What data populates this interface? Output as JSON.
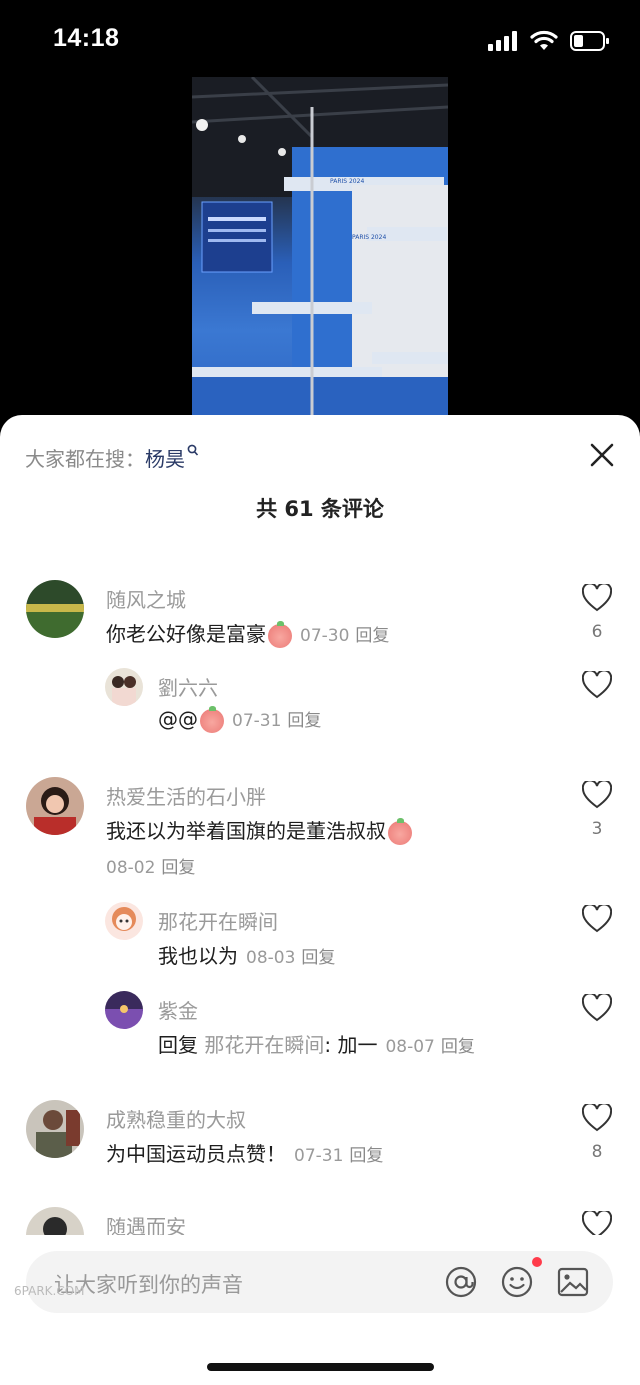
{
  "status_bar": {
    "time": "14:18"
  },
  "video": {
    "screen_text": "PARIS 2024"
  },
  "sheet": {
    "search_hint_label": "大家都在搜：",
    "search_term": "杨昊",
    "comment_count_title": "共 61 条评论"
  },
  "comments": [
    {
      "user": "随风之城",
      "text": "你老公好像是富豪",
      "date": "07-30",
      "reply_label": "回复",
      "likes": "6",
      "replies": [
        {
          "user": "劉六六",
          "text": "@@",
          "date": "07-31",
          "reply_label": "回复"
        }
      ]
    },
    {
      "user": "热爱生活的石小胖",
      "text": "我还以为举着国旗的是董浩叔叔",
      "date": "08-02",
      "reply_label": "回复",
      "likes": "3",
      "replies": [
        {
          "user": "那花开在瞬间",
          "text": "我也以为",
          "date": "08-03",
          "reply_label": "回复"
        },
        {
          "user": "紫金",
          "text_prefix": "回复",
          "quoted_user": "那花开在瞬间",
          "text": ": 加一",
          "date": "08-07",
          "reply_label": "回复"
        }
      ]
    },
    {
      "user": "成熟稳重的大叔",
      "text": "为中国运动员点赞！",
      "date": "07-31",
      "reply_label": "回复",
      "likes": "8"
    },
    {
      "user": "随遇而安"
    }
  ],
  "input": {
    "placeholder": "让大家听到你的声音"
  },
  "watermark": "6PARK.COM",
  "colors": {
    "accent_dot": "#ff3b4a",
    "sheet_bg": "#ffffff",
    "input_bg": "#f3f3f3"
  }
}
